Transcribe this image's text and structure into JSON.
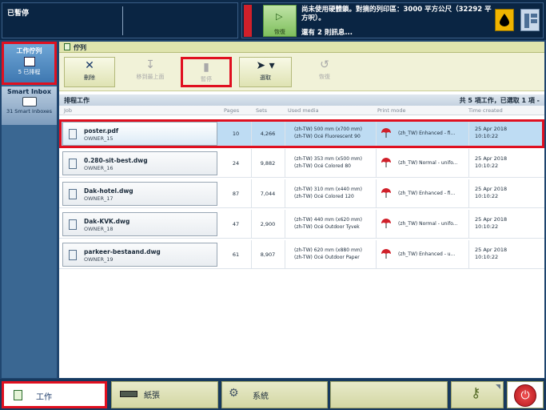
{
  "status": {
    "left_title": "已暫停",
    "warning_text": "尚未使用硬體鎖。對摘的列印區：3000 平方公尺（32292 平方呎）。",
    "warning_sub": "還有 2 則訊息...",
    "resume_label": "恢復"
  },
  "nav": {
    "queue_title": "工作佇列",
    "queue_sub": "5 已排程",
    "inbox_title": "Smart Inbox",
    "inbox_sub": "31 Smart Inboxes"
  },
  "main": {
    "header_title": "佇列",
    "toolbar": {
      "delete": "刪除",
      "move_top": "移到最上面",
      "pause": "暫停",
      "select": "選取",
      "resume": "恢復"
    },
    "section_title": "排程工作",
    "section_summary": "共 5 項工作，已選取 1 項 -",
    "columns": {
      "job": "Job",
      "pages": "Pages",
      "sets": "Sets",
      "media": "Used media",
      "mode": "Print mode",
      "time": "Time created"
    },
    "rows": [
      {
        "name": "poster.pdf",
        "owner": "OWNER_15",
        "pages": "10",
        "sets": "4,266",
        "media1": "(zh-TW) 500 mm (x700 mm)",
        "media2": "(zh-TW) Océ Fluorescent 90",
        "mode": "(zh_TW) Enhanced - fi...",
        "date": "25 Apr 2018",
        "time": "10:10:22"
      },
      {
        "name": "0.280-sit-best.dwg",
        "owner": "OWNER_16",
        "pages": "24",
        "sets": "9,882",
        "media1": "(zh-TW) 353 mm (x500 mm)",
        "media2": "(zh-TW) Océ Colored 80",
        "mode": "(zh_TW) Normal - unifo...",
        "date": "25 Apr 2018",
        "time": "10:10:22"
      },
      {
        "name": "Dak-hotel.dwg",
        "owner": "OWNER_17",
        "pages": "87",
        "sets": "7,044",
        "media1": "(zh-TW) 310 mm (x440 mm)",
        "media2": "(zh-TW) Océ Colored 120",
        "mode": "(zh_TW) Enhanced - fi...",
        "date": "25 Apr 2018",
        "time": "10:10:22"
      },
      {
        "name": "Dak-KVK.dwg",
        "owner": "OWNER_18",
        "pages": "47",
        "sets": "2,900",
        "media1": "(zh-TW) 440 mm (x620 mm)",
        "media2": "(zh-TW) Océ Outdoor Tyvek",
        "mode": "(zh_TW) Normal - unifo...",
        "date": "25 Apr 2018",
        "time": "10:10:22"
      },
      {
        "name": "parkeer-bestaand.dwg",
        "owner": "OWNER_19",
        "pages": "61",
        "sets": "8,907",
        "media1": "(zh-TW) 620 mm (x880 mm)",
        "media2": "(zh-TW) Océ Outdoor Paper",
        "mode": "(zh_TW) Enhanced - u...",
        "date": "25 Apr 2018",
        "time": "10:10:22"
      }
    ]
  },
  "bottom": {
    "work": "工作",
    "paper": "紙張",
    "system": "系統"
  },
  "icons": {
    "resume": "play-triangle-icon",
    "ink": "ink-drop-icon",
    "panel": "control-panel-icon",
    "printer": "printer-icon",
    "inbox": "folder-icon",
    "delete": "close-x-icon",
    "move_top": "move-top-icon",
    "pause": "pause-icon",
    "select": "cursor-icon",
    "resume_job": "resume-icon",
    "job": "document-icon",
    "print_mode": "umbrella-icon",
    "paper": "paper-roll-icon",
    "system": "gears-icon",
    "key": "key-icon",
    "power": "power-icon"
  },
  "colors": {
    "highlight": "#e01020",
    "selected_row": "#bedcf3",
    "status_bg": "#0a2543"
  }
}
